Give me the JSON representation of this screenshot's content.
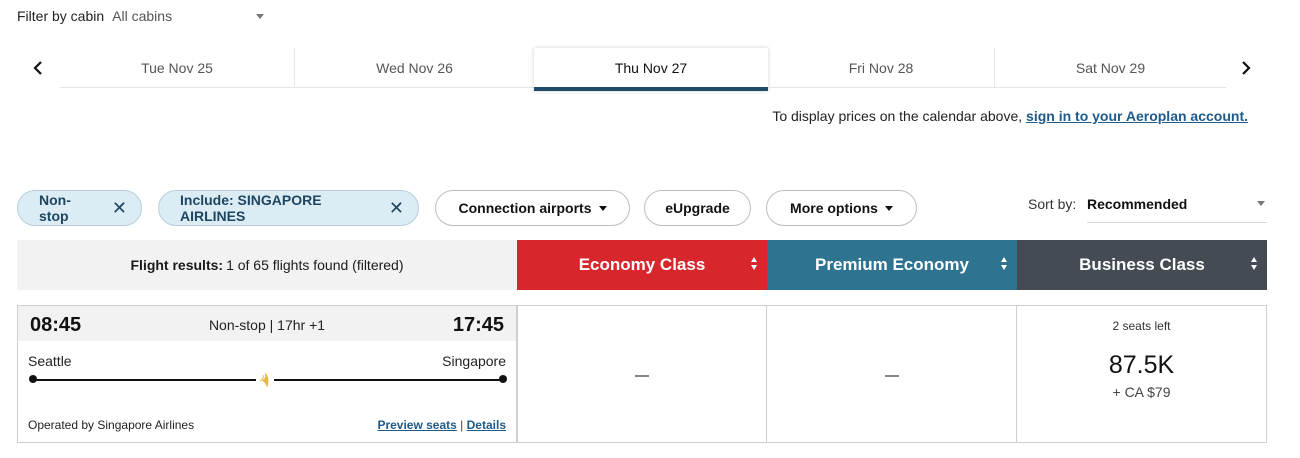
{
  "cabin_filter": {
    "label": "Filter by cabin",
    "value": "All cabins"
  },
  "dates": [
    {
      "label": "Tue Nov 25",
      "active": false
    },
    {
      "label": "Wed Nov 26",
      "active": false
    },
    {
      "label": "Thu Nov 27",
      "active": true
    },
    {
      "label": "Fri Nov 28",
      "active": false
    },
    {
      "label": "Sat Nov 29",
      "active": false
    }
  ],
  "nav": {
    "prev_icon": "chevron-left-icon",
    "next_icon": "chevron-right-icon"
  },
  "signin": {
    "text": "To display prices on the calendar above,",
    "link": "sign in to your Aeroplan account."
  },
  "filters": {
    "nonstop": "Non-stop",
    "include_airline": "Include: SINGAPORE AIRLINES",
    "connection_airports": "Connection airports",
    "eupgrade": "eUpgrade",
    "more_options": "More options"
  },
  "sort": {
    "label": "Sort by:",
    "value": "Recommended"
  },
  "results": {
    "label": "Flight results:",
    "count_text": "1 of 65 flights found (filtered)"
  },
  "cabins": [
    {
      "label": "Economy Class",
      "color": "#d8262d"
    },
    {
      "label": "Premium Economy",
      "color": "#2e7390"
    },
    {
      "label": "Business Class",
      "color": "#444b53"
    }
  ],
  "flight": {
    "departure_time": "08:45",
    "arrival_time": "17:45",
    "duration": "Non-stop | 17hr +1",
    "origin": "Seattle",
    "destination": "Singapore",
    "operated_by": "Operated by Singapore Airlines",
    "preview_seats": "Preview seats",
    "separator": "|",
    "details": "Details",
    "economy": "—",
    "premium_economy": "—",
    "business": {
      "seats_left": "2 seats left",
      "points": "87.5K",
      "cash": "+ CA $79"
    }
  }
}
